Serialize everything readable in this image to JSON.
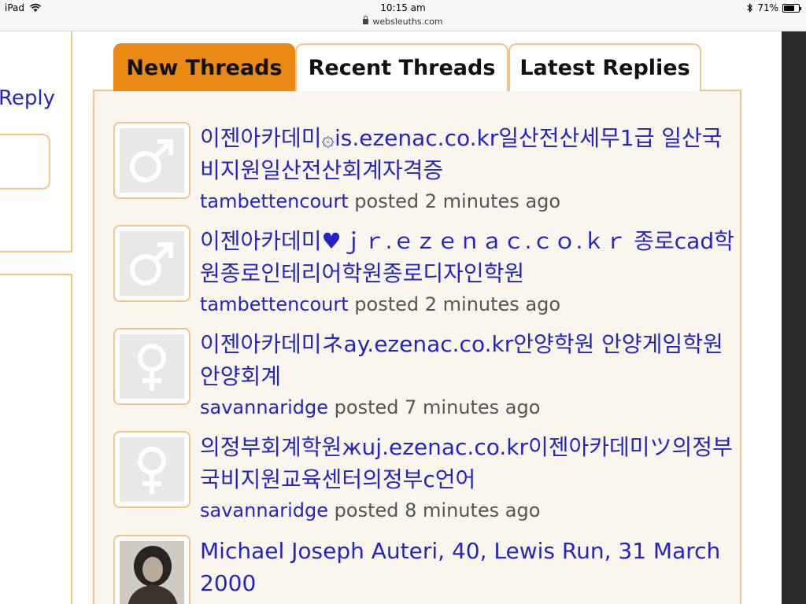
{
  "status_bar": {
    "device": "iPad",
    "time": "10:15 am",
    "url": "websleuths.com",
    "battery": "71%",
    "battery_level": 0.71
  },
  "sidebar": {
    "reply_label": "Reply"
  },
  "tabs": [
    {
      "label": "New Threads",
      "active": true
    },
    {
      "label": "Recent Threads",
      "active": false
    },
    {
      "label": "Latest Replies",
      "active": false
    }
  ],
  "threads": [
    {
      "title": "이젠아카데미۞is.ezenac.co.kr일산전산세무1급 일산국비지원일산전산회계자격증",
      "user": "tambettencourt",
      "meta": " posted 2 minutes ago",
      "avatar": "male-icon"
    },
    {
      "title": "이젠아카데미♥ｊｒ.ｅｚｅｎａｃ.ｃｏ.ｋｒ 종로cad학원종로인테리어학원종로디자인학원",
      "user": "tambettencourt",
      "meta": " posted 2 minutes ago",
      "avatar": "male-icon"
    },
    {
      "title": "이젠아카데미ネay.ezenac.co.kr안양학원 안양게임학원안양회계",
      "user": "savannaridge",
      "meta": " posted 7 minutes ago",
      "avatar": "female-icon"
    },
    {
      "title": "의정부회계학원жuj.ezenac.co.kr이젠아카데미ツ의정부국비지원교육센터의정부c언어",
      "user": "savannaridge",
      "meta": " posted 8 minutes ago",
      "avatar": "female-icon"
    },
    {
      "title": "Michael Joseph Auteri, 40, Lewis Run, 31 March 2000",
      "user": "",
      "meta": "",
      "avatar": "photo"
    }
  ]
}
